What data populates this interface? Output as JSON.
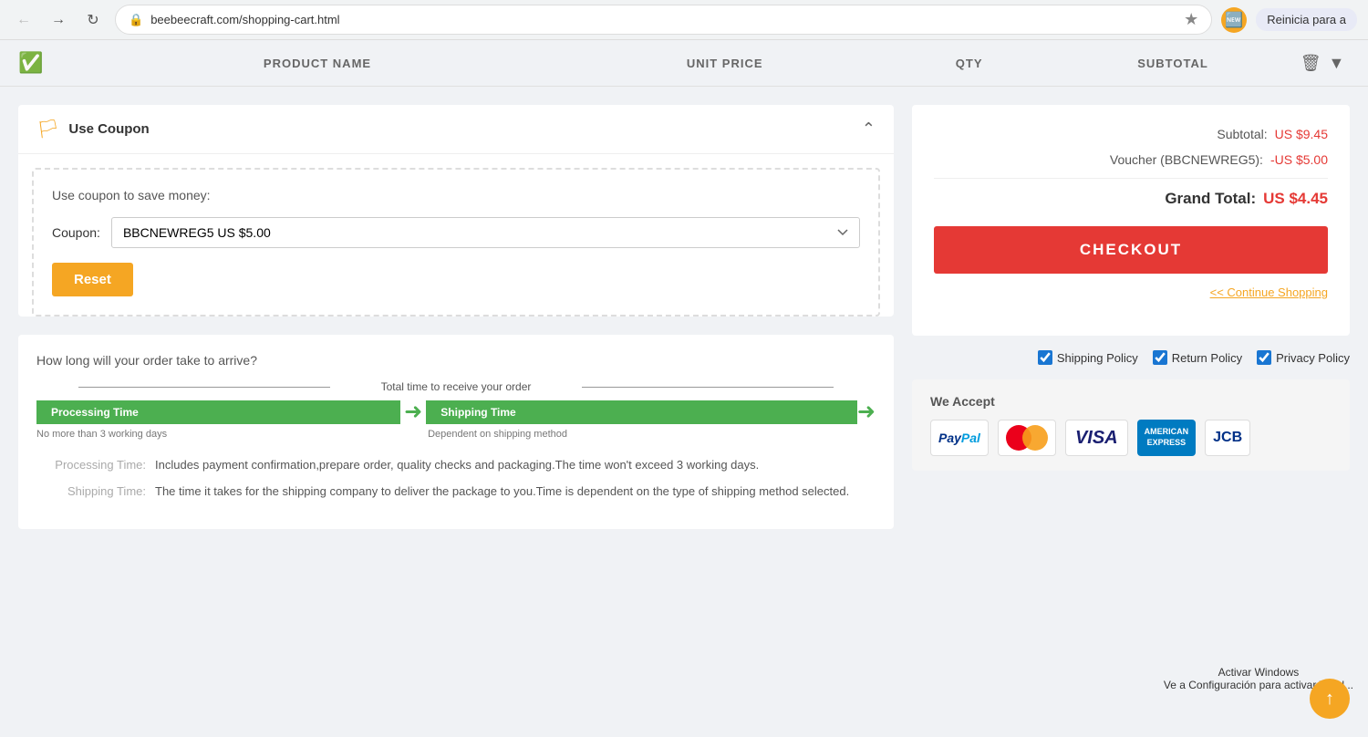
{
  "browser": {
    "url": "beebeecraft.com/shopping-cart.html",
    "reinicia_label": "Reinicia para a"
  },
  "table_header": {
    "product_name": "PRODUCT NAME",
    "unit_price": "UNIT PRICE",
    "qty": "QTY",
    "subtotal": "SUBTOTAL"
  },
  "coupon": {
    "section_title": "Use Coupon",
    "save_text": "Use coupon to save money:",
    "coupon_label": "Coupon:",
    "coupon_code": "BBCNEWREG5",
    "coupon_value": "US $5.00",
    "reset_label": "Reset"
  },
  "shipping": {
    "question": "How long will your order take to arrive?",
    "total_label": "Total time to receive your order",
    "processing_bar": "Processing Time",
    "shipping_bar": "Shipping Time",
    "processing_sublabel": "No more than 3 working days",
    "shipping_sublabel": "Dependent on shipping method",
    "processing_label": "Processing Time:",
    "processing_desc": "Includes payment confirmation,prepare order, quality checks and packaging.The time won't exceed 3 working days.",
    "shipping_label": "Shipping Time:",
    "shipping_desc": "The time it takes for the shipping company to deliver the package to you.Time is dependent on the type of shipping method selected."
  },
  "order_summary": {
    "subtotal_label": "Subtotal:",
    "subtotal_value": "US $9.45",
    "voucher_label": "Voucher (BBCNEWREG5):",
    "voucher_value": "-US $5.00",
    "grand_total_label": "Grand Total:",
    "grand_total_value": "US $4.45",
    "checkout_label": "CHECKOUT",
    "continue_shopping": "<< Continue Shopping"
  },
  "policies": {
    "shipping": "Shipping Policy",
    "returns": "Return Policy",
    "privacy": "Privacy Policy"
  },
  "payment": {
    "title": "We Accept"
  },
  "activate": {
    "line1": "Activar Windows",
    "line2": "Ve a Configuración para activar Wind..."
  }
}
